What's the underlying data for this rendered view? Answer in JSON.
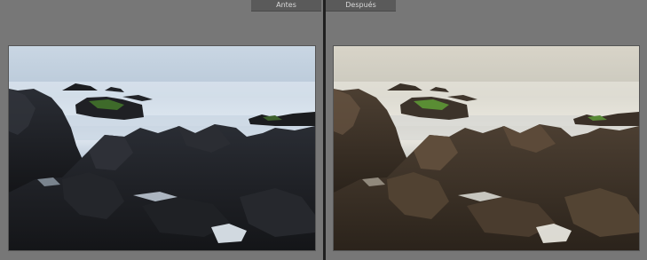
{
  "compare": {
    "before_label": "Antes",
    "after_label": "Después"
  },
  "colors": {
    "background": "#777777",
    "divider": "#1f1f1f",
    "label_bg": "#5a5a5a",
    "label_text": "#d8d8d8"
  }
}
